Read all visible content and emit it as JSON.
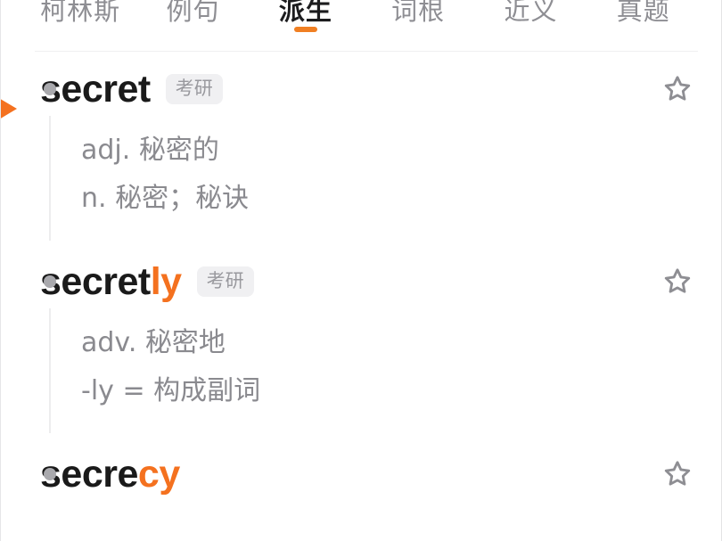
{
  "theme": {
    "accent": "#f4711f",
    "word_color": "#1a1a1a",
    "muted_text": "#8a8a8f",
    "tab_inactive": "#8e8e93",
    "tab_active": "#1c1c1e",
    "tag_bg": "#f0f0f2",
    "tag_text": "#99999e",
    "bullet": "#a9a9ad",
    "divider": "#f0f0f1",
    "star_outline": "#8e8e93"
  },
  "tabs": [
    {
      "label": "柯林斯",
      "active": false
    },
    {
      "label": "例句",
      "active": false
    },
    {
      "label": "派生",
      "active": true
    },
    {
      "label": "词根",
      "active": false
    },
    {
      "label": "近义",
      "active": false
    },
    {
      "label": "真题",
      "active": false
    }
  ],
  "cursor": {
    "icon": "arrow-pointer-icon"
  },
  "entries": [
    {
      "stem": "secret",
      "suffix": "",
      "tag": "考研",
      "favorite_icon": "star-outline-icon",
      "definitions": [
        "adj. 秘密的",
        "n. 秘密；秘诀"
      ]
    },
    {
      "stem": "secret",
      "suffix": "ly",
      "tag": "考研",
      "favorite_icon": "star-outline-icon",
      "definitions": [
        "adv. 秘密地",
        "-ly = 构成副词"
      ]
    },
    {
      "stem": "secre",
      "suffix": "cy",
      "tag": "",
      "favorite_icon": "star-outline-icon",
      "definitions": []
    }
  ]
}
